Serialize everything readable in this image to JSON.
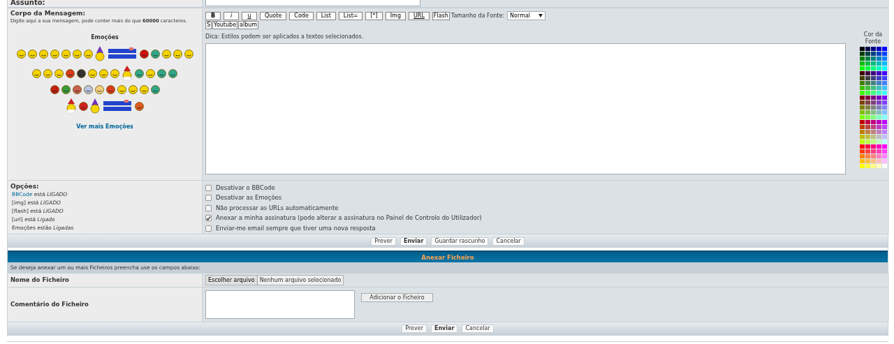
{
  "subject": {
    "label": "Assunto:"
  },
  "message": {
    "label": "Corpo da Mensagem:",
    "hint": "Digite aqui a sua mensagem, pode conter mais do que **60000** caracteres.",
    "emoticons_title": "Emoções",
    "more_emoticons": "Ver mais Emoções"
  },
  "toolbar": [
    {
      "label": "B",
      "kind": "bold"
    },
    {
      "label": "i",
      "kind": "italic"
    },
    {
      "label": "u",
      "kind": "underline"
    },
    {
      "label": "Quote",
      "kind": "plain"
    },
    {
      "label": "Code",
      "kind": "plain"
    },
    {
      "label": "List",
      "kind": "plain"
    },
    {
      "label": "List=",
      "kind": "plain"
    },
    {
      "label": "[*]",
      "kind": "plain"
    },
    {
      "label": "Img",
      "kind": "plain"
    },
    {
      "label": "URL",
      "kind": "underline"
    },
    {
      "label": "Flash",
      "kind": "compact"
    }
  ],
  "font_size": {
    "label": "Tamanho da Fonte:",
    "value": "Normal"
  },
  "toolbar_row2": [
    "S",
    "Youtube",
    "album"
  ],
  "tip": "Dica: Estilos podem ser aplicados a textos selecionados.",
  "font_color_label": "Cor da Fonte",
  "options": {
    "label": "Opções:",
    "status": [
      {
        "link": "BBCode",
        "text": " está *LIGADO*"
      },
      {
        "text": "[img] está *LIGADO*"
      },
      {
        "text": "[flash] está *LIGADO*"
      },
      {
        "text": "[url] está *Ligado*"
      },
      {
        "text": "Emoções estão *Ligadas*"
      }
    ],
    "checkboxes": [
      {
        "label": "Desativar o BBCode",
        "checked": false
      },
      {
        "label": "Desativar as Emoções",
        "checked": false
      },
      {
        "label": "Não processar as URLs automaticamente",
        "checked": false
      },
      {
        "label": "Anexar a minha assinatura (pode alterar a assinatura no Painel de Controlo do Utilizador)",
        "checked": true
      },
      {
        "label": "Enviar-me email sempre que tiver uma nova resposta",
        "checked": false
      }
    ]
  },
  "actions": [
    {
      "label": "Prever",
      "primary": false
    },
    {
      "label": "Enviar",
      "primary": true
    },
    {
      "label": "Guardar rascunho",
      "primary": false
    },
    {
      "label": "Cancelar",
      "primary": false
    }
  ],
  "attach": {
    "title": "Anexar Ficheiro",
    "info": "Se deseja anexar um ou mais Ficheiros preencha use os campos abaixo:",
    "file_label": "Nome do Ficheiro",
    "choose_button": "Escolher arquivo",
    "no_file": "Nenhum arquivo selecionado",
    "comment_label": "Comentário do Ficheiro",
    "add_button": "Adicionar o Ficheiro",
    "actions": [
      {
        "label": "Prever",
        "primary": false
      },
      {
        "label": "Enviar",
        "primary": true
      },
      {
        "label": "Cancelar",
        "primary": false
      }
    ]
  }
}
